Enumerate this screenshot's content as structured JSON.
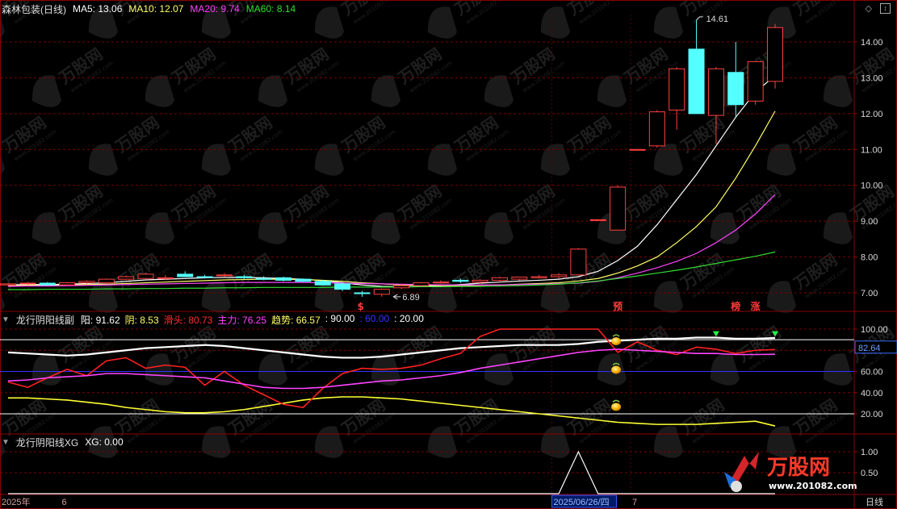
{
  "colors": {
    "bg": "#000000",
    "grid": "#7a0000",
    "axis_text": "#d9d9d9",
    "up_candle": "#ff4040",
    "down_candle": "#54ffff",
    "ma5": "#ffffff",
    "ma10": "#ffff66",
    "ma20": "#ff44ff",
    "ma60": "#33dd33"
  },
  "top_icons": [
    "diamond-icon",
    "scroll-box-icon"
  ],
  "main_panel": {
    "title": "森林包装(日线)",
    "indicators": [
      {
        "label": "MA5: 13.06",
        "color": "#ffffff"
      },
      {
        "label": "MA10: 12.07",
        "color": "#ffff66"
      },
      {
        "label": "MA20: 9.74",
        "color": "#ff44ff"
      },
      {
        "label": "MA60: 8.14",
        "color": "#33dd33"
      }
    ],
    "high_marker": "14.61",
    "low_marker": "6.89",
    "signals": [
      "$",
      "预",
      "榜",
      "涨"
    ]
  },
  "sub_panel": {
    "title": "龙行阴阳线副",
    "indicators": [
      {
        "label": "阳: 91.62",
        "color": "#ffffff"
      },
      {
        "label": "阴: 8.53",
        "color": "#ffff66"
      },
      {
        "label": "滑头: 80.73",
        "color": "#ff3030"
      },
      {
        "label": "主力: 76.25",
        "color": "#ff44ff"
      },
      {
        "label": "趋势: 66.57",
        "color": "#ffff66"
      },
      {
        "label": ": 90.00",
        "color": "#ffffff"
      },
      {
        "label": ": 60.00",
        "color": "#3333ff"
      },
      {
        "label": ": 20.00",
        "color": "#ffffff"
      }
    ],
    "current_value": "82.64"
  },
  "xg_panel": {
    "title": "龙行阴阳线XG",
    "indicators": [
      {
        "label": "XG: 0.00",
        "color": "#ffffff"
      }
    ]
  },
  "x_axis": {
    "labels": [
      {
        "text": "2025年",
        "index": 0
      },
      {
        "text": "6",
        "index": 3
      },
      {
        "text": "2025/06/26/四",
        "index": 28,
        "highlight": true
      },
      {
        "text": "7",
        "index": 32
      }
    ],
    "period": "日线"
  },
  "watermark": {
    "brand": "万股网",
    "site": "www.201082.com"
  },
  "chart_data": {
    "type": "candlestick",
    "panels": [
      {
        "name": "price",
        "ylim": [
          6.7,
          14.8
        ],
        "yticks": [
          7.0,
          8.0,
          9.0,
          10.0,
          11.0,
          12.0,
          13.0,
          14.0
        ],
        "candles": [
          [
            7.22,
            7.27,
            7.2,
            7.25
          ],
          [
            7.25,
            7.3,
            7.22,
            7.27
          ],
          [
            7.27,
            7.3,
            7.2,
            7.22
          ],
          [
            7.22,
            7.3,
            7.2,
            7.28
          ],
          [
            7.28,
            7.35,
            7.25,
            7.32
          ],
          [
            7.28,
            7.4,
            7.25,
            7.38
          ],
          [
            7.38,
            7.48,
            7.35,
            7.45
          ],
          [
            7.4,
            7.55,
            7.38,
            7.52
          ],
          [
            7.4,
            7.5,
            7.35,
            7.42
          ],
          [
            7.52,
            7.6,
            7.48,
            7.45
          ],
          [
            7.45,
            7.5,
            7.4,
            7.44
          ],
          [
            7.48,
            7.55,
            7.45,
            7.5
          ],
          [
            7.45,
            7.5,
            7.38,
            7.42
          ],
          [
            7.4,
            7.46,
            7.35,
            7.38
          ],
          [
            7.42,
            7.45,
            7.32,
            7.35
          ],
          [
            7.38,
            7.4,
            7.3,
            7.32
          ],
          [
            7.32,
            7.36,
            7.2,
            7.22
          ],
          [
            7.25,
            7.3,
            7.05,
            7.1
          ],
          [
            7.0,
            7.05,
            6.89,
            6.98
          ],
          [
            6.96,
            7.12,
            6.89,
            7.1
          ],
          [
            7.14,
            7.25,
            7.1,
            7.2
          ],
          [
            7.2,
            7.3,
            7.18,
            7.28
          ],
          [
            7.28,
            7.35,
            7.25,
            7.3
          ],
          [
            7.35,
            7.4,
            7.28,
            7.32
          ],
          [
            7.3,
            7.38,
            7.25,
            7.35
          ],
          [
            7.35,
            7.45,
            7.3,
            7.42
          ],
          [
            7.38,
            7.45,
            7.35,
            7.44
          ],
          [
            7.42,
            7.5,
            7.4,
            7.45
          ],
          [
            7.45,
            7.55,
            7.4,
            7.5
          ],
          [
            7.5,
            8.25,
            7.48,
            8.22
          ],
          [
            9.04,
            9.04,
            9.04,
            9.04
          ],
          [
            8.75,
            10.0,
            8.75,
            9.95
          ],
          [
            11.0,
            11.0,
            11.0,
            11.0
          ],
          [
            11.1,
            12.1,
            11.05,
            12.05
          ],
          [
            12.1,
            13.3,
            11.55,
            13.25
          ],
          [
            13.8,
            14.61,
            12.0,
            12.0
          ],
          [
            11.95,
            13.3,
            11.15,
            13.25
          ],
          [
            13.15,
            14.0,
            11.9,
            12.25
          ],
          [
            12.35,
            13.45,
            12.25,
            13.45
          ],
          [
            12.9,
            14.5,
            12.7,
            14.4
          ]
        ],
        "series": [
          {
            "name": "MA5",
            "values": [
              7.22,
              7.23,
              7.23,
              7.24,
              7.26,
              7.28,
              7.32,
              7.36,
              7.38,
              7.4,
              7.42,
              7.43,
              7.43,
              7.42,
              7.4,
              7.38,
              7.34,
              7.28,
              7.22,
              7.18,
              7.17,
              7.18,
              7.2,
              7.23,
              7.27,
              7.3,
              7.33,
              7.35,
              7.38,
              7.45,
              7.6,
              7.9,
              8.3,
              8.9,
              9.6,
              10.3,
              11.1,
              11.9,
              12.6,
              13.06
            ]
          },
          {
            "name": "MA10",
            "values": [
              7.2,
              7.21,
              7.21,
              7.22,
              7.23,
              7.24,
              7.26,
              7.28,
              7.3,
              7.32,
              7.34,
              7.36,
              7.37,
              7.38,
              7.38,
              7.37,
              7.35,
              7.32,
              7.28,
              7.25,
              7.22,
              7.21,
              7.2,
              7.2,
              7.21,
              7.22,
              7.24,
              7.26,
              7.28,
              7.33,
              7.4,
              7.55,
              7.75,
              8.0,
              8.4,
              8.85,
              9.4,
              10.2,
              11.1,
              12.07
            ]
          },
          {
            "name": "MA20",
            "values": [
              7.18,
              7.19,
              7.19,
              7.2,
              7.21,
              7.22,
              7.23,
              7.24,
              7.25,
              7.26,
              7.27,
              7.28,
              7.29,
              7.29,
              7.29,
              7.29,
              7.28,
              7.27,
              7.26,
              7.25,
              7.24,
              7.23,
              7.22,
              7.22,
              7.22,
              7.22,
              7.23,
              7.24,
              7.25,
              7.27,
              7.32,
              7.42,
              7.55,
              7.7,
              7.88,
              8.1,
              8.4,
              8.75,
              9.2,
              9.74
            ]
          },
          {
            "name": "MA60",
            "values": [
              7.09,
              7.09,
              7.1,
              7.1,
              7.1,
              7.11,
              7.11,
              7.12,
              7.12,
              7.13,
              7.13,
              7.14,
              7.14,
              7.15,
              7.15,
              7.15,
              7.15,
              7.16,
              7.16,
              7.16,
              7.16,
              7.17,
              7.17,
              7.18,
              7.18,
              7.19,
              7.2,
              7.22,
              7.24,
              7.28,
              7.33,
              7.4,
              7.47,
              7.55,
              7.63,
              7.72,
              7.82,
              7.92,
              8.02,
              8.14
            ]
          }
        ]
      },
      {
        "name": "龙行阴阳线副",
        "ylim": [
          0,
          105
        ],
        "yticks": [
          20.0,
          40.0,
          60.0,
          80.0,
          100.0
        ],
        "hlines": [
          {
            "value": 90,
            "color": "#ffffff"
          },
          {
            "value": 60,
            "color": "#3333ff"
          },
          {
            "value": 20,
            "color": "#ffffff"
          }
        ],
        "series": [
          {
            "name": "阳",
            "values": [
              78,
              77,
              76,
              75,
              76,
              78,
              80,
              82,
              83,
              84,
              85,
              84,
              82,
              80,
              78,
              76,
              74,
              73,
              73,
              74,
              76,
              78,
              80,
              82,
              83,
              84,
              85,
              85,
              85,
              86,
              88,
              89,
              90,
              91,
              91,
              92,
              92,
              91,
              91,
              91.62
            ]
          },
          {
            "name": "阴",
            "values": [
              35,
              35,
              34,
              33,
              31,
              29,
              26,
              24,
              22,
              21,
              21,
              22,
              24,
              27,
              30,
              33,
              35,
              36,
              36,
              35,
              34,
              32,
              30,
              28,
              26,
              24,
              22,
              20,
              18,
              16,
              14,
              12,
              11,
              10,
              10,
              10,
              11,
              12,
              13,
              8.53
            ]
          },
          {
            "name": "滑头",
            "values": [
              50,
              45,
              54,
              62,
              56,
              70,
              73,
              63,
              66,
              64,
              47,
              60,
              47,
              38,
              29,
              26,
              44,
              58,
              63,
              62,
              63,
              66,
              72,
              77,
              93,
              100,
              100,
              100,
              100,
              100,
              100,
              78,
              88,
              80,
              76,
              83,
              81,
              77,
              80,
              80.73
            ]
          },
          {
            "name": "主力",
            "values": [
              51,
              52,
              54,
              55,
              56,
              58,
              58,
              57,
              56,
              55,
              54,
              51,
              48,
              45,
              44,
              44,
              45,
              47,
              49,
              51,
              52,
              54,
              56,
              59,
              63,
              66,
              69,
              72,
              75,
              78,
              80,
              81,
              80,
              79,
              78,
              77,
              77,
              76,
              76,
              76.25
            ]
          }
        ]
      },
      {
        "name": "龙行阴阳线XG",
        "ylim": [
          0,
          1.15
        ],
        "yticks": [
          0.5,
          1.0
        ],
        "series": [
          {
            "name": "XG",
            "values": [
              0,
              0,
              0,
              0,
              0,
              0,
              0,
              0,
              0,
              0,
              0,
              0,
              0,
              0,
              0,
              0,
              0,
              0,
              0,
              0,
              0,
              0,
              0,
              0,
              0,
              0,
              0,
              0,
              0,
              1,
              0,
              0,
              0,
              0,
              0,
              0,
              0,
              0,
              0,
              0
            ]
          }
        ]
      }
    ]
  }
}
